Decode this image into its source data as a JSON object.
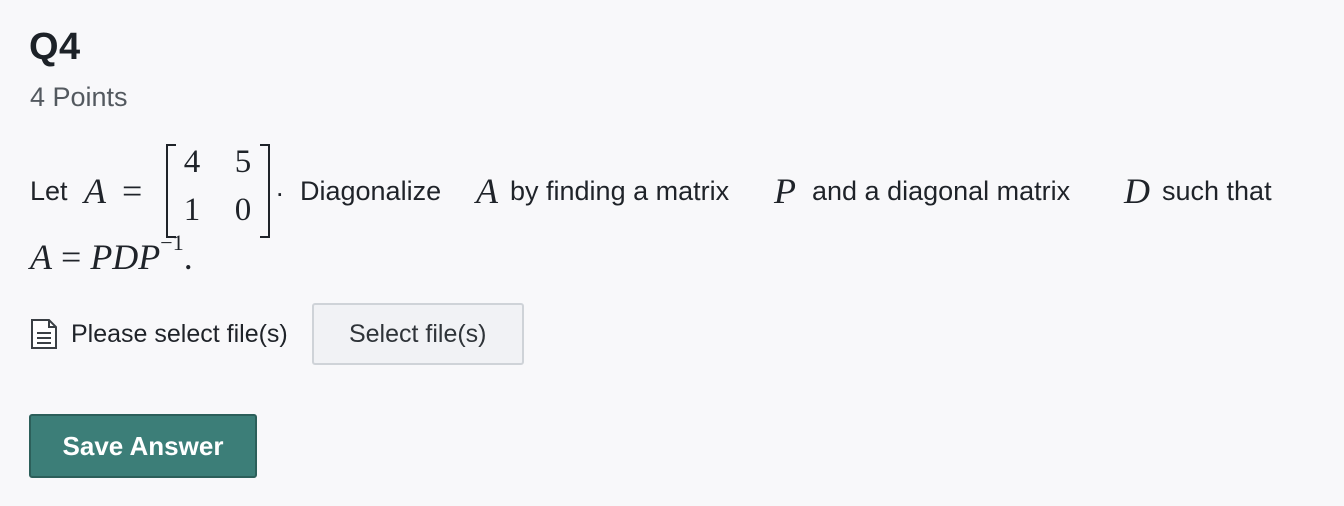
{
  "question": {
    "title": "Q4",
    "points": "4 Points",
    "text": {
      "let": "Let",
      "var_a": "A",
      "equals": "=",
      "matrix": [
        [
          "4",
          "5"
        ],
        [
          "1",
          "0"
        ]
      ],
      "period": ".",
      "diagonalize": "Diagonalize",
      "var_a2": "A",
      "by_finding": "by finding a matrix",
      "var_p": "P",
      "and_diag": "and a diagonal matrix",
      "var_d": "D",
      "such_that": "such that",
      "equation_lhs": "A",
      "equation_eq": "=",
      "equation_rhs": "PDP",
      "equation_exp": "−1",
      "equation_end": "."
    }
  },
  "upload": {
    "icon": "document-icon",
    "label": "Please select file(s)",
    "button_label": "Select file(s)"
  },
  "actions": {
    "save_label": "Save Answer",
    "save_color": "#3c7e78"
  }
}
